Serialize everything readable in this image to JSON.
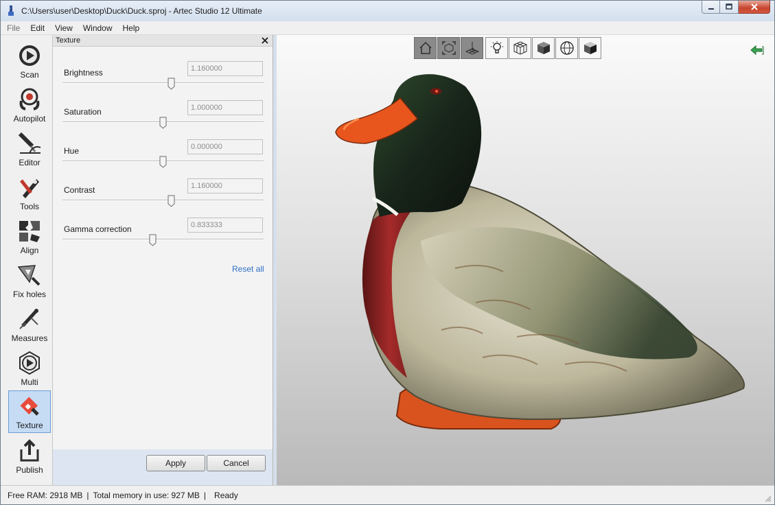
{
  "window": {
    "title": "C:\\Users\\user\\Desktop\\Duck\\Duck.sproj - Artec Studio 12 Ultimate"
  },
  "menu": [
    "File",
    "Edit",
    "View",
    "Window",
    "Help"
  ],
  "tools": [
    {
      "label": "Scan",
      "icon": "scan-icon"
    },
    {
      "label": "Autopilot",
      "icon": "autopilot-icon"
    },
    {
      "label": "Editor",
      "icon": "editor-icon"
    },
    {
      "label": "Tools",
      "icon": "tools-icon"
    },
    {
      "label": "Align",
      "icon": "align-icon"
    },
    {
      "label": "Fix holes",
      "icon": "fix-holes-icon"
    },
    {
      "label": "Measures",
      "icon": "measures-icon"
    },
    {
      "label": "Multi",
      "icon": "multi-icon"
    },
    {
      "label": "Texture",
      "icon": "texture-icon",
      "active": true
    },
    {
      "label": "Publish",
      "icon": "publish-icon"
    }
  ],
  "panel": {
    "title": "Texture",
    "params": [
      {
        "label": "Brightness",
        "value": "1.160000",
        "level": 0.54
      },
      {
        "label": "Saturation",
        "value": "1.000000",
        "level": 0.5
      },
      {
        "label": "Hue",
        "value": "0.000000",
        "level": 0.5
      },
      {
        "label": "Contrast",
        "value": "1.160000",
        "level": 0.54
      },
      {
        "label": "Gamma correction",
        "value": "0.833333",
        "level": 0.45
      }
    ],
    "reset_label": "Reset all",
    "apply_label": "Apply",
    "cancel_label": "Cancel"
  },
  "viewport_toolbar": [
    {
      "icon": "home-view-icon",
      "pressed": true
    },
    {
      "icon": "fit-view-icon",
      "pressed": true
    },
    {
      "icon": "grid-icon",
      "pressed": true
    },
    {
      "icon": "light-bulb-icon",
      "pressed": false
    },
    {
      "icon": "wireframe-cube-icon",
      "pressed": false
    },
    {
      "icon": "solid-cube-icon",
      "pressed": false
    },
    {
      "icon": "sphere-icon",
      "pressed": false
    },
    {
      "icon": "textured-cube-icon",
      "pressed": false
    }
  ],
  "status": {
    "free_ram": "Free RAM: 2918 MB",
    "total_memory": "Total memory in use: 927 MB",
    "state": "Ready"
  },
  "colors": {
    "accent": "#2e6fc4",
    "active_tool_bg": "#c6dcf4",
    "panel_footer": "#dce5f1"
  }
}
